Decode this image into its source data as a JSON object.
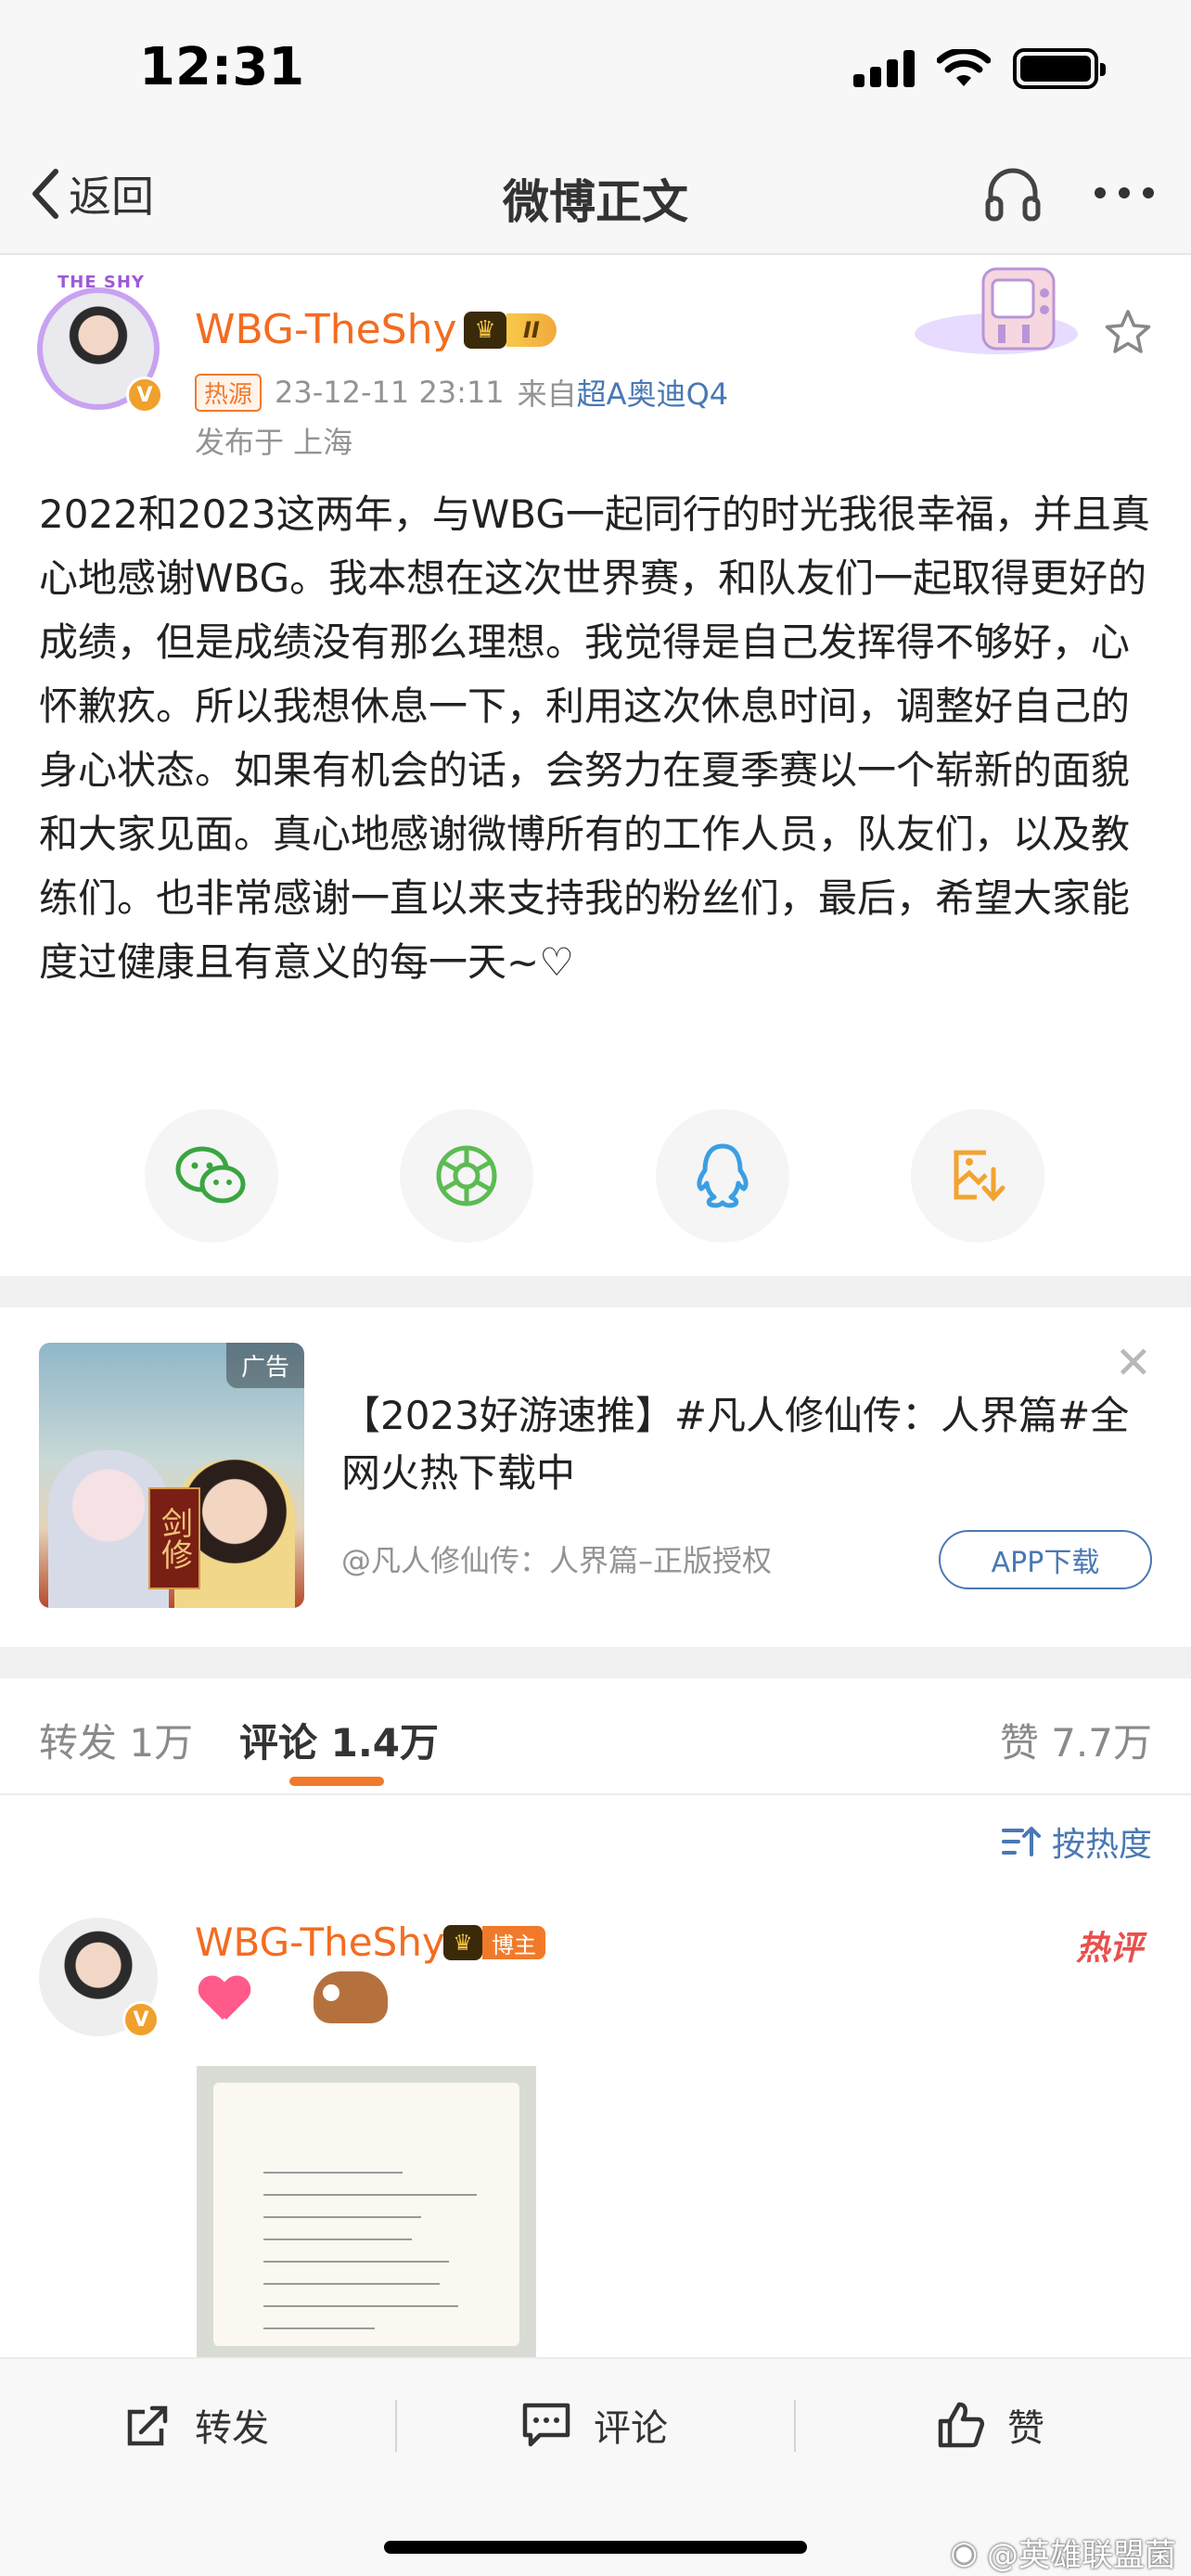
{
  "status_bar": {
    "time": "12:31"
  },
  "nav": {
    "back_label": "返回",
    "title": "微博正文"
  },
  "post": {
    "author": "WBG-TheShy",
    "avatar_frame_text": "THE SHY",
    "level_label": "II",
    "verified_mark": "V",
    "hot_tag": "热源",
    "time": "23-12-11 23:11",
    "source_prefix": "来自",
    "source": "超A奥迪Q4",
    "location": "发布于 上海",
    "text": "2022和2023这两年，与WBG一起同行的时光我很幸福，并且真心地感谢WBG。我本想在这次世界赛，和队友们一起取得更好的成绩，但是成绩没有那么理想。我觉得是自己发挥得不够好，心怀歉疚。所以我想休息一下，利用这次休息时间，调整好自己的身心状态。如果有机会的话，会努力在夏季赛以一个崭新的面貌和大家见面。真心地感谢微博所有的工作人员，队友们，以及教练们。也非常感谢一直以来支持我的粉丝们，最后，希望大家能度过健康且有意义的每一天~♡"
  },
  "share": [
    "wechat-icon",
    "moments-icon",
    "qq-icon",
    "save-image-icon"
  ],
  "ad": {
    "tag": "广告",
    "image_text": "剑修",
    "title": "【2023好游速推】#凡人修仙传：人界篇#全网火热下载中",
    "author": "@凡人修仙传：人界篇–正版授权",
    "button": "APP下载"
  },
  "tabs": {
    "repost": "转发 1万",
    "comment": "评论 1.4万",
    "like": "赞 7.7万"
  },
  "sort": {
    "label": "按热度"
  },
  "comment": {
    "author": "WBG-TheShy",
    "owner_label": "博主",
    "hot_label": "热评",
    "verified_mark": "V"
  },
  "bottom_bar": {
    "repost": "转发",
    "comment": "评论",
    "like": "赞"
  },
  "watermark": "@英雄联盟菌",
  "colors": {
    "accent": "#f36c21",
    "link": "#4a78b3",
    "hot": "#e8504d"
  }
}
